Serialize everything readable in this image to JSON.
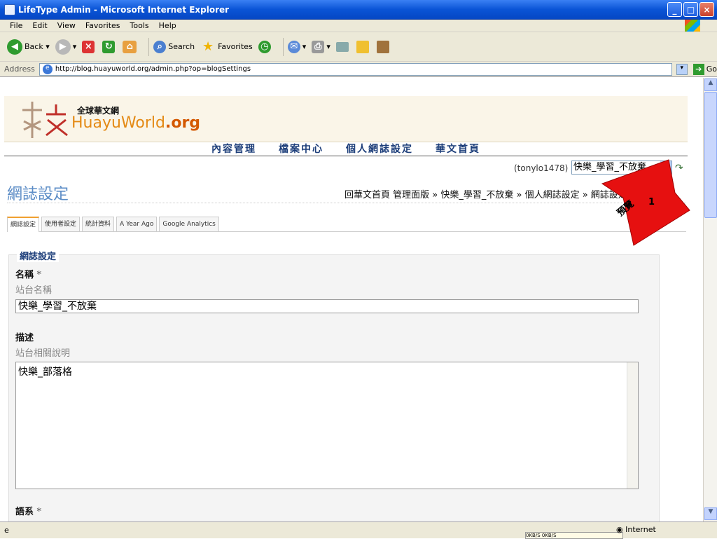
{
  "window": {
    "title": "LifeType Admin - Microsoft Internet Explorer"
  },
  "menu": [
    "File",
    "Edit",
    "View",
    "Favorites",
    "Tools",
    "Help"
  ],
  "toolbar": {
    "back": "Back",
    "search": "Search",
    "favorites": "Favorites"
  },
  "address": {
    "label": "Address",
    "url": "http://blog.huayuworld.org/admin.php?op=blogSettings",
    "go": "Go"
  },
  "logo": {
    "zh": "全球華文網",
    "en_main": "HuayuWorld",
    "en_suffix": ".org"
  },
  "topnav": [
    "內容管理",
    "檔案中心",
    "個人網誌設定",
    "華文首頁"
  ],
  "user": {
    "name": "(tonylo1478)",
    "blog_selected": "快樂_學習_不放棄"
  },
  "page": {
    "title": "網誌設定"
  },
  "breadcrumb": "回華文首頁 管理面版 » 快樂_學習_不放棄 » 個人網誌設定 » 網誌設定",
  "tabs": [
    "網誌設定",
    "使用者設定",
    "統計資料",
    "A Year Ago",
    "Google Analytics"
  ],
  "form": {
    "legend": "網誌設定",
    "name_label": "名稱",
    "required_mark": "*",
    "name_hint": "站台名稱",
    "name_value": "快樂_學習_不放棄",
    "desc_label": "描述",
    "desc_hint": "站台相關說明",
    "desc_value": "快樂_部落格",
    "lang_label": "語系"
  },
  "annotation": {
    "text": "預覽",
    "number": "1",
    "color": "#e61010"
  },
  "status": {
    "zone": "Internet",
    "net": "0KB/S   0KB/S"
  }
}
